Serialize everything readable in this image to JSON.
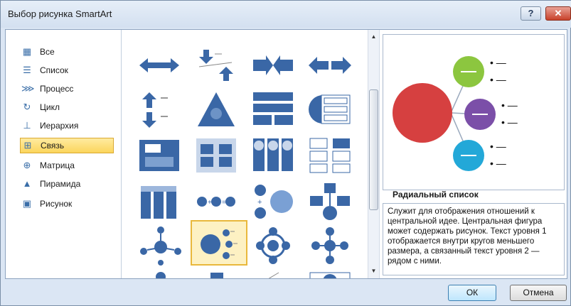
{
  "window": {
    "title": "Выбор рисунка SmartArt",
    "help_label": "?",
    "close_label": "✕"
  },
  "categories": [
    {
      "label": "Все",
      "icon": "all-icon"
    },
    {
      "label": "Список",
      "icon": "list-icon"
    },
    {
      "label": "Процесс",
      "icon": "process-icon"
    },
    {
      "label": "Цикл",
      "icon": "cycle-icon"
    },
    {
      "label": "Иерархия",
      "icon": "hierarchy-icon"
    },
    {
      "label": "Связь",
      "icon": "relationship-icon",
      "selected": true
    },
    {
      "label": "Матрица",
      "icon": "matrix-icon"
    },
    {
      "label": "Пирамида",
      "icon": "pyramid-icon"
    },
    {
      "label": "Рисунок",
      "icon": "picture-icon"
    }
  ],
  "gallery": {
    "selected_index": 17
  },
  "preview": {
    "title": "Радиальный список",
    "description": "Служит для отображения отношений к центральной идее. Центральная фигура может содержать рисунок. Текст уровня 1 отображается внутри кругов меньшего размера, а связанный текст уровня 2 — рядом с ними.",
    "bullet_text": "• —"
  },
  "buttons": {
    "ok": "ОК",
    "cancel": "Отмена"
  },
  "colors": {
    "center": "#d64040",
    "green": "#8cc63f",
    "purple": "#7b4fa8",
    "cyan": "#23a8d8",
    "thumb_blue": "#3a67a6"
  }
}
